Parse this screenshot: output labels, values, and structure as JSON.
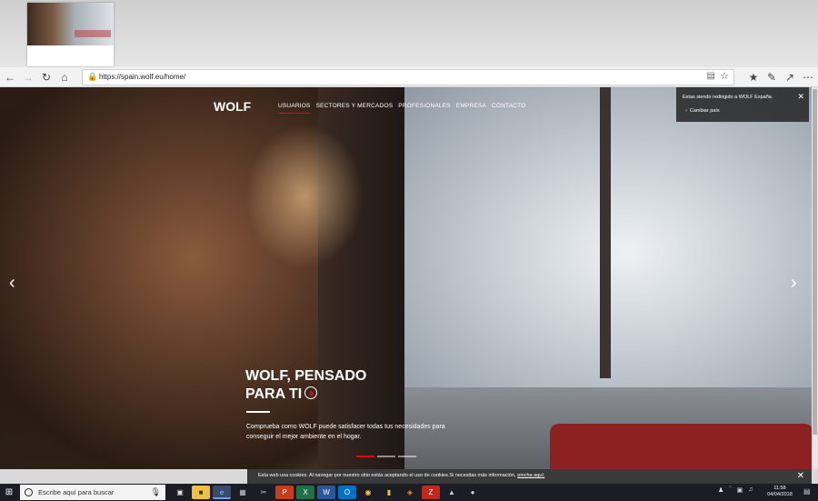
{
  "browser": {
    "url": "https://spain.wolf.eu/home/",
    "icons": {
      "back": "back-arrow-icon",
      "forward": "forward-arrow-icon",
      "refresh": "refresh-icon",
      "home": "home-icon"
    },
    "toolbar_right": [
      "favorites-icon",
      "pen-icon",
      "share-icon",
      "more-icon"
    ]
  },
  "site": {
    "logo": "WOLF",
    "nav": [
      "USUARIOS",
      "SECTORES Y MERCADOS",
      "PROFESIONALES",
      "EMPRESA",
      "CONTACTO"
    ],
    "hero": {
      "title_line1": "WOLF, PENSADO",
      "title_line2": "PARA TI",
      "subtitle": "Comprueba como WOLF puede satisfacer todas tus necesidades para conseguir el mejor ambiente en el hogar."
    },
    "redirect": {
      "message": "Estas siendo redirigido a WOLF España.",
      "link": "Cambiar país"
    },
    "cookie": {
      "text": "Esta web usa cookies. Al navegar por nuestro sitio estás aceptando el uso de cookies.Si necesitas más información,",
      "link": "pincha aquí."
    }
  },
  "taskbar": {
    "search_placeholder": "Escribe aquí para buscar",
    "time": "11:58",
    "date": "04/04/2018"
  }
}
